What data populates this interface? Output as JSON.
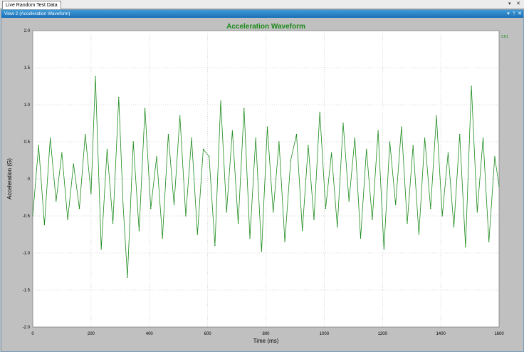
{
  "document_tab": {
    "label": "Live Random Test Data"
  },
  "tabstrip_controls": {
    "dropdown": "▾",
    "close": "✕"
  },
  "view": {
    "title": "View 2 (Acceleration Waveform)",
    "controls": {
      "dropdown": "▾",
      "pin": "ᛘ",
      "close": "✕"
    }
  },
  "colors": {
    "series": "#1a8a1a",
    "title": "#1a8a1a",
    "plot_bg": "#ffffff",
    "window_bg": "#c0c0c0",
    "titlebar": "#2a80c8"
  },
  "chart_data": {
    "type": "line",
    "title": "Acceleration Waveform",
    "xlabel": "Time (ms)",
    "ylabel": "Acceleration (G)",
    "xlim": [
      0,
      1600
    ],
    "ylim": [
      -2.0,
      2.0
    ],
    "xticks": [
      "0",
      "200",
      "400",
      "600",
      "800",
      "1000",
      "1200",
      "1400",
      "1600"
    ],
    "yticks": [
      "2.0",
      "1.5",
      "1.0",
      "0.5",
      "0",
      "-0.5",
      "-1.0",
      "-1.5",
      "-2.0"
    ],
    "grid": true,
    "legend_position": "top-right",
    "series": [
      {
        "name": "CH1",
        "x": [
          0,
          20,
          40,
          60,
          80,
          100,
          120,
          140,
          160,
          180,
          200,
          215,
          235,
          255,
          275,
          295,
          310,
          325,
          345,
          365,
          385,
          405,
          425,
          445,
          465,
          485,
          505,
          525,
          545,
          565,
          585,
          605,
          625,
          645,
          665,
          685,
          705,
          725,
          745,
          765,
          785,
          805,
          825,
          845,
          865,
          885,
          905,
          925,
          945,
          965,
          985,
          1005,
          1025,
          1045,
          1065,
          1085,
          1105,
          1125,
          1145,
          1165,
          1185,
          1205,
          1225,
          1245,
          1265,
          1285,
          1305,
          1325,
          1345,
          1365,
          1385,
          1405,
          1425,
          1445,
          1465,
          1485,
          1505,
          1525,
          1545,
          1565,
          1585,
          1600
        ],
        "y": [
          -0.5,
          0.45,
          -0.62,
          0.55,
          -0.3,
          0.35,
          -0.55,
          0.2,
          -0.4,
          0.6,
          -0.2,
          1.38,
          -0.95,
          0.4,
          -0.6,
          1.1,
          -0.35,
          -1.33,
          0.5,
          -0.7,
          0.95,
          -0.4,
          0.3,
          -0.8,
          0.6,
          -0.35,
          0.85,
          -0.5,
          0.55,
          -0.75,
          0.4,
          0.3,
          -0.9,
          1.05,
          -0.45,
          0.65,
          -0.6,
          0.95,
          -0.8,
          0.55,
          -0.98,
          0.7,
          -0.45,
          0.5,
          -0.85,
          0.25,
          0.6,
          -0.7,
          0.45,
          -0.55,
          0.9,
          -0.4,
          0.35,
          -0.65,
          0.75,
          -0.3,
          0.55,
          -0.8,
          0.4,
          -0.55,
          0.65,
          -0.95,
          0.5,
          -0.35,
          0.7,
          -0.6,
          0.45,
          -0.75,
          0.55,
          -0.4,
          0.85,
          -0.5,
          0.35,
          -0.65,
          0.6,
          -0.92,
          1.25,
          -0.45,
          0.55,
          -0.85,
          0.3,
          -0.1
        ]
      }
    ]
  }
}
